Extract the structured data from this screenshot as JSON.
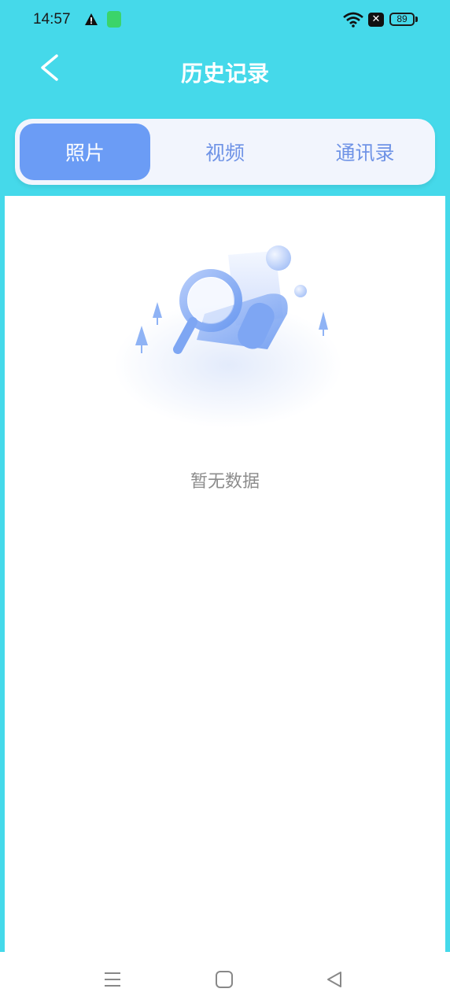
{
  "status_bar": {
    "time": "14:57",
    "battery": "89"
  },
  "header": {
    "title": "历史记录"
  },
  "tabs": [
    {
      "label": "照片",
      "active": true
    },
    {
      "label": "视频",
      "active": false
    },
    {
      "label": "通讯录",
      "active": false
    }
  ],
  "empty_state": {
    "message": "暂无数据",
    "illustration": "magnifier-document-illustration"
  },
  "colors": {
    "header_bg": "#45d9ea",
    "tab_active": "#6b9cf5",
    "tab_text": "#6f93e6"
  },
  "nav": {
    "icons": [
      "menu-icon",
      "home-icon",
      "back-triangle-icon"
    ]
  }
}
